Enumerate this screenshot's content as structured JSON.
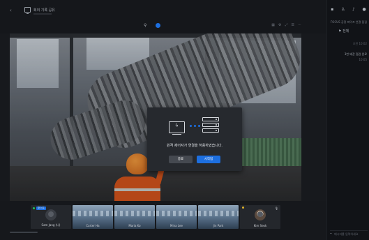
{
  "topbar": {
    "back_icon": "chevron-left-icon",
    "title": "회의 기록 공유",
    "icons": [
      "video-icon",
      "person-icon",
      "volume-icon",
      "user-icon"
    ]
  },
  "stage": {
    "toolbar_icons": [
      "pin-icon",
      "record-dot-icon"
    ],
    "view_tools": [
      "grid-icon",
      "settings-icon",
      "layout-icon",
      "list-icon",
      "more-icon"
    ]
  },
  "modal": {
    "message": "원격 제어자가 연결을 허용하였습니다.",
    "cancel_label": "종료",
    "confirm_label": "시작됨",
    "accent": "#1d6fe0"
  },
  "participants": [
    {
      "name": "Sam Jang (나)",
      "type": "avatar",
      "badge": "호스트",
      "online": true
    },
    {
      "name": "Carter Ha",
      "type": "video"
    },
    {
      "name": "Maria Ko",
      "type": "video"
    },
    {
      "name": "Mina Lee",
      "type": "video"
    },
    {
      "name": "Jin Park",
      "type": "video"
    },
    {
      "name": "Kim Seok",
      "type": "photo",
      "online": true
    }
  ],
  "right_panel": {
    "header": "FOCUS 공정 파이프 연결 점검",
    "filter": "전체",
    "line1": "오전 10:02",
    "line2": "3번 배관 점검 완료",
    "line3": "10:05",
    "input_placeholder": "메시지를 입력하세요"
  }
}
